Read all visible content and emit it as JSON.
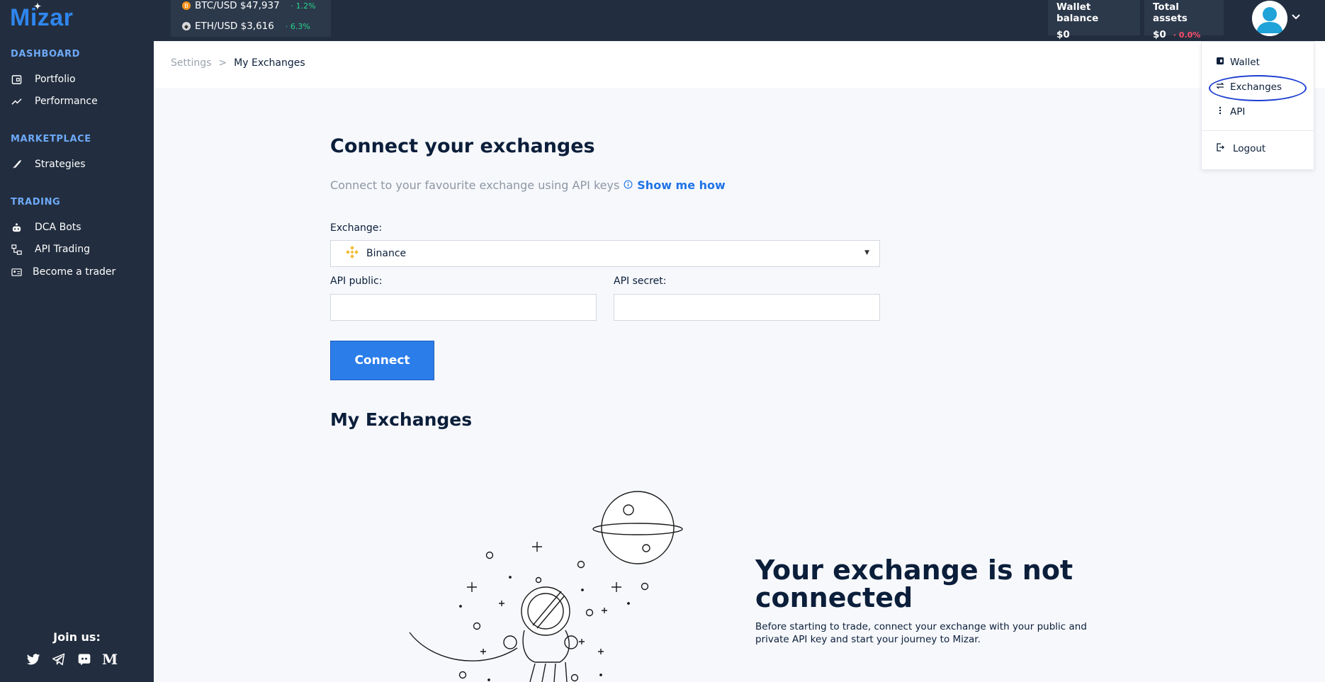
{
  "app": {
    "logo": "Mizar"
  },
  "sidebar": {
    "sections": [
      {
        "title": "DASHBOARD",
        "items": [
          {
            "label": "Portfolio",
            "icon": "portfolio-icon"
          },
          {
            "label": "Performance",
            "icon": "trend-icon"
          }
        ]
      },
      {
        "title": "MARKETPLACE",
        "items": [
          {
            "label": "Strategies",
            "icon": "rocket-icon"
          }
        ]
      },
      {
        "title": "TRADING",
        "items": [
          {
            "label": "DCA Bots",
            "icon": "bot-icon"
          },
          {
            "label": "API Trading",
            "icon": "api-trading-icon"
          },
          {
            "label": "Become a trader",
            "icon": "trader-card-icon"
          }
        ]
      }
    ],
    "join": "Join us:",
    "socials": [
      "twitter-icon",
      "telegram-icon",
      "discord-icon",
      "medium-icon"
    ]
  },
  "topbar": {
    "tickers": [
      {
        "pair": "BTC/USD $47,937",
        "change": "· 1.2%",
        "coin": "B",
        "color": "#f7931a"
      },
      {
        "pair": "ETH/USD $3,616",
        "change": "· 6.3%",
        "coin": "◆",
        "color": "#8c8c8c"
      }
    ],
    "wallet_balance": {
      "label": "Wallet balance",
      "value": "$0"
    },
    "total_assets": {
      "label": "Total assets",
      "value": "$0",
      "change": "· 0.0%"
    }
  },
  "breadcrumb": {
    "parent": "Settings",
    "separator": ">",
    "current": "My Exchanges"
  },
  "connect": {
    "title": "Connect your exchanges",
    "subtitle": "Connect to your favourite exchange using API keys",
    "show_me_how": "Show me how",
    "exchange_label": "Exchange:",
    "exchange_value": "Binance",
    "api_public_label": "API public:",
    "api_secret_label": "API secret:",
    "connect_button": "Connect"
  },
  "my_exchanges": {
    "title": "My Exchanges",
    "empty_title": "Your exchange is not connected",
    "empty_text": "Before starting to trade, connect your exchange with your public and private API key and start your journey to Mizar."
  },
  "user_menu": {
    "items": [
      {
        "label": "Wallet",
        "icon": "wallet-icon"
      },
      {
        "label": "Exchanges",
        "icon": "exchange-arrows-icon"
      },
      {
        "label": "API",
        "icon": "api-icon"
      },
      {
        "label": "Logout",
        "icon": "logout-icon"
      }
    ]
  },
  "colors": {
    "accent": "#2b7de9",
    "sidebar_bg": "#222e3f",
    "positive": "#28d48a",
    "negative": "#ff4d6a",
    "highlight": "#1d3fd1"
  }
}
